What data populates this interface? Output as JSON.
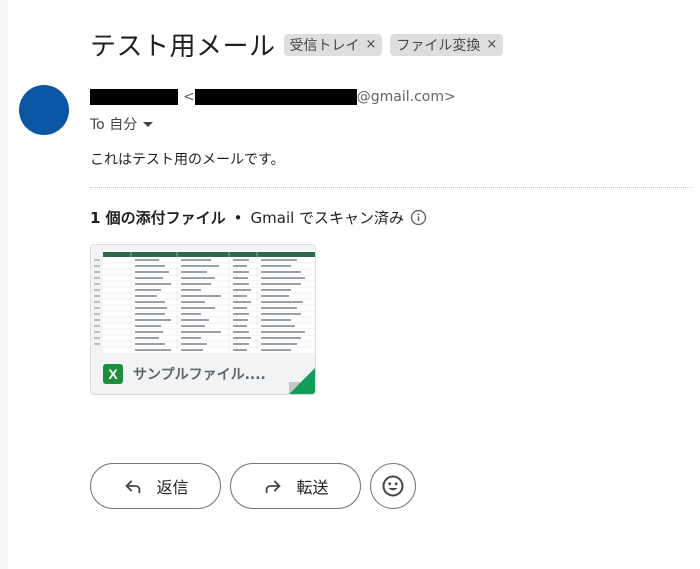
{
  "subject": "テスト用メール",
  "labels": [
    {
      "name": "受信トレイ",
      "remove": "×"
    },
    {
      "name": "ファイル変換",
      "remove": "×"
    }
  ],
  "sender": {
    "lt": "<",
    "email_domain": "@gmail.com>"
  },
  "recipient": {
    "to_text": "To 自分"
  },
  "body": {
    "text": "これはテスト用のメールです。"
  },
  "attachments": {
    "count_text": "1 個の添付ファイル",
    "separator": "•",
    "scan_text": "Gmail でスキャン済み",
    "file": {
      "icon_letter": "X",
      "name": "サンプルファイル...."
    }
  },
  "actions": {
    "reply": "返信",
    "forward": "転送"
  },
  "colors": {
    "avatar": "#0b57a4",
    "excel_green": "#1e8e3e",
    "sheet_header": "#2e6b4a"
  }
}
